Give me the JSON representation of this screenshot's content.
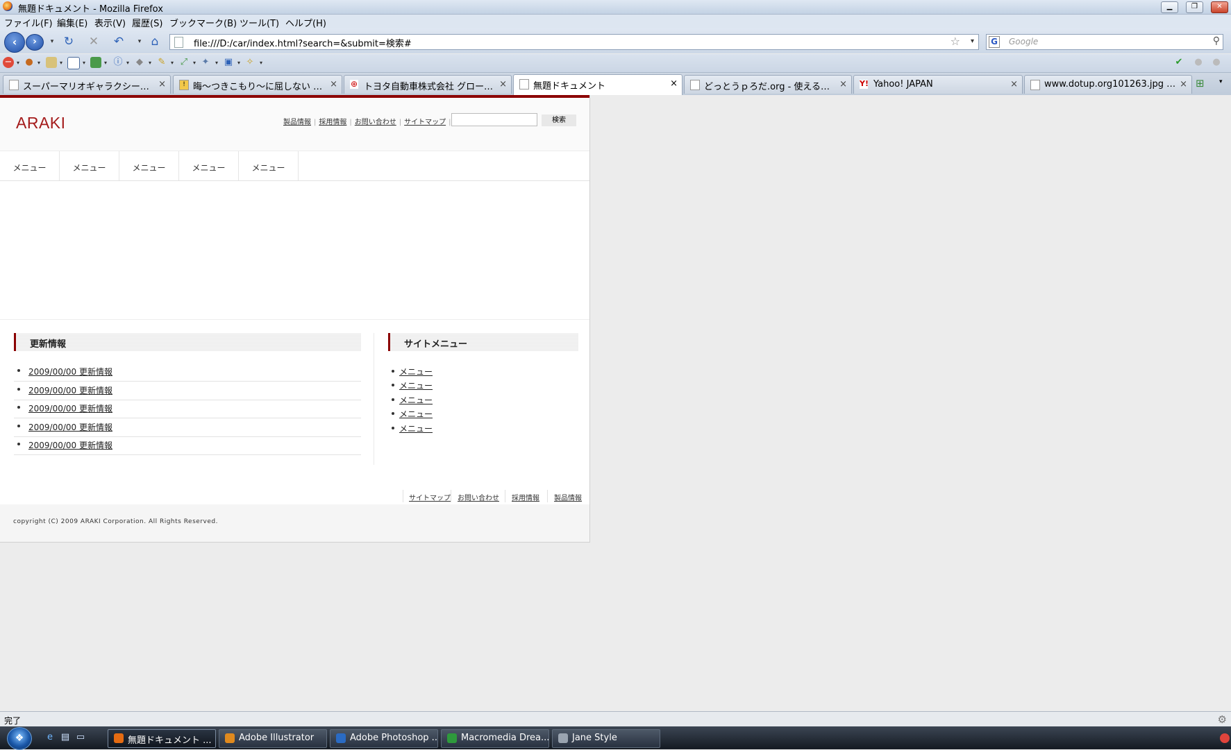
{
  "window": {
    "title": "無題ドキュメント - Mozilla Firefox",
    "controls": [
      "▁",
      "❐",
      "✕"
    ]
  },
  "menubar": [
    "ファイル(F)",
    "編集(E)",
    "表示(V)",
    "履歴(S)",
    "ブックマーク(B)",
    "ツール(T)",
    "ヘルプ(H)"
  ],
  "nav": {
    "url": "file:///D:/car/index.html?search=&submit=検索#",
    "search_placeholder": "Google"
  },
  "tabs": [
    {
      "label": "スーパーマリオギャラクシーウイ...",
      "icon": "page-icon"
    },
    {
      "label": "晦〜つきこもり〜に屈しない part1...",
      "icon": "warning-page-icon"
    },
    {
      "label": "トヨタ自動車株式会社 グローバ...",
      "icon": "toyota-icon"
    },
    {
      "label": "無題ドキュメント",
      "icon": "page-icon",
      "active": true
    },
    {
      "label": "どっとうｐろだ.org - 使えるアッ...",
      "icon": "page-icon"
    },
    {
      "label": "Yahoo! JAPAN",
      "icon": "yahoo-icon"
    },
    {
      "label": "www.dotup.org101263.jpg (JP...",
      "icon": "page-icon"
    }
  ],
  "site": {
    "logo": "ARAKI",
    "top_links": [
      "製品情報",
      "採用情報",
      "お問い合わせ",
      "サイトマップ"
    ],
    "search_button": "検索",
    "global_nav": [
      "メニュー",
      "メニュー",
      "メニュー",
      "メニュー",
      "メニュー"
    ],
    "news": {
      "heading": "更新情報",
      "items": [
        "2009/00/00 更新情報",
        "2009/00/00 更新情報",
        "2009/00/00 更新情報",
        "2009/00/00 更新情報",
        "2009/00/00 更新情報"
      ]
    },
    "site_menu": {
      "heading": "サイトメニュー",
      "items": [
        "メニュー",
        "メニュー",
        "メニュー",
        "メニュー",
        "メニュー"
      ]
    },
    "footer_links": [
      "サイトマップ",
      "お問い合わせ",
      "採用情報",
      "製品情報"
    ],
    "copyright": "copyright (C) 2009 ARAKI Corporation. All Rights Reserved."
  },
  "status": {
    "text": "完了"
  },
  "taskbar": [
    {
      "label": "無題ドキュメント ...",
      "icon": "firefox-icon",
      "color": "#e56b12",
      "active": true
    },
    {
      "label": "Adobe Illustrator",
      "icon": "illustrator-icon",
      "color": "#e08a1e"
    },
    {
      "label": "Adobe Photoshop ...",
      "icon": "photoshop-icon",
      "color": "#2a6bc4"
    },
    {
      "label": "Macromedia Drea...",
      "icon": "dreamweaver-icon",
      "color": "#2e9a3c"
    },
    {
      "label": "Jane Style",
      "icon": "jane-style-icon",
      "color": "#9aa4b0"
    }
  ],
  "colors": {
    "brand_red": "#8b0000",
    "logo_red": "#a41b1b"
  }
}
